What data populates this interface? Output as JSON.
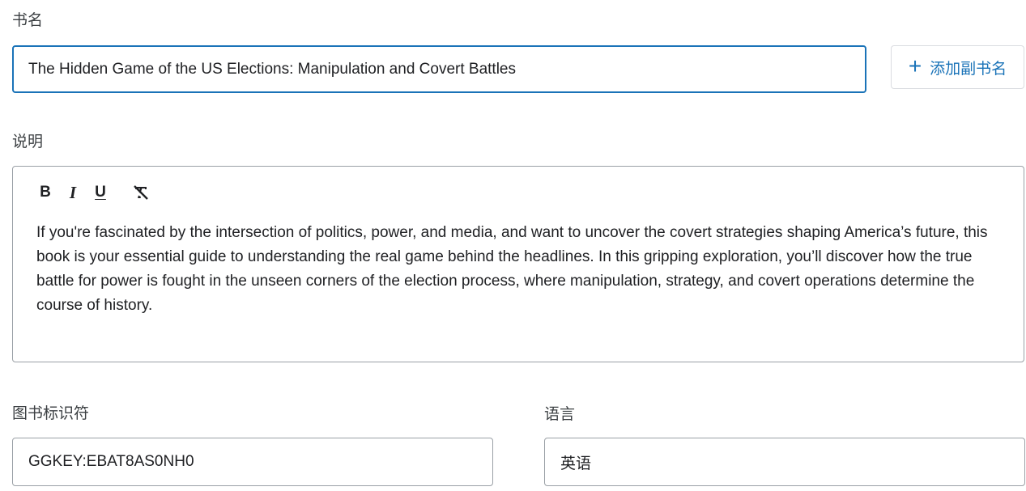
{
  "title_field": {
    "label": "书名",
    "value": "The Hidden Game of the US Elections: Manipulation and Covert Battles"
  },
  "add_subtitle": {
    "label": "添加副书名",
    "icon": "plus-icon"
  },
  "description": {
    "label": "说明",
    "toolbar": {
      "bold": "B",
      "italic": "I",
      "underline": "U",
      "clear_icon": "clear-format-icon"
    },
    "text": "If you're fascinated by the intersection of politics, power, and media, and want to uncover the covert strategies shaping America’s future, this book is your essential guide to understanding the real game behind the headlines. In this gripping exploration, you’ll discover how the true battle for power is fought in the unseen corners of the election process, where manipulation, strategy, and covert operations determine the course of history."
  },
  "identifier_field": {
    "label": "图书标识符",
    "value": "GGKEY:EBAT8AS0NH0"
  },
  "language_field": {
    "label": "语言",
    "value": "英语"
  },
  "colors": {
    "accent": "#1a73b8",
    "border": "#9aa0a6",
    "text": "#202124"
  }
}
